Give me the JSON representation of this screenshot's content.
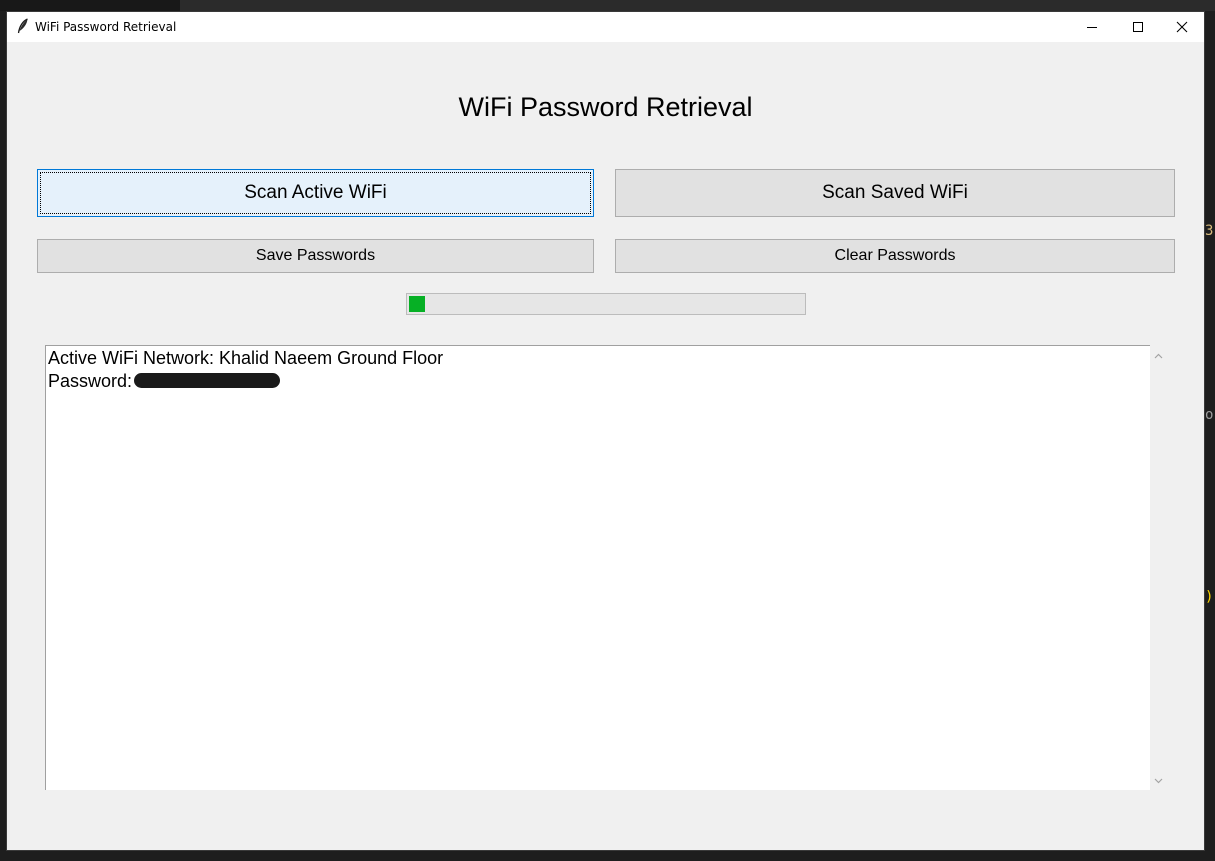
{
  "window": {
    "title": "WiFi Password Retrieval"
  },
  "app": {
    "heading": "WiFi Password Retrieval"
  },
  "buttons": {
    "scan_active": "Scan Active WiFi",
    "scan_saved": "Scan Saved WiFi",
    "save_passwords": "Save Passwords",
    "clear_passwords": "Clear Passwords"
  },
  "progress": {
    "fraction": 0.04,
    "color": "#06b025"
  },
  "output": {
    "line1": "Active WiFi Network: Khalid Naeem Ground Floor",
    "line2_label": "Password:"
  },
  "icons": {
    "window_icon": "feather-icon",
    "minimize": "minimize-icon",
    "maximize": "maximize-icon",
    "close": "close-icon",
    "scroll_up": "chevron-up-icon",
    "scroll_down": "chevron-down-icon"
  },
  "colors": {
    "window_bg": "#f0f0f0",
    "focus_border": "#0078d7",
    "focus_bg": "#e5f1fb"
  }
}
